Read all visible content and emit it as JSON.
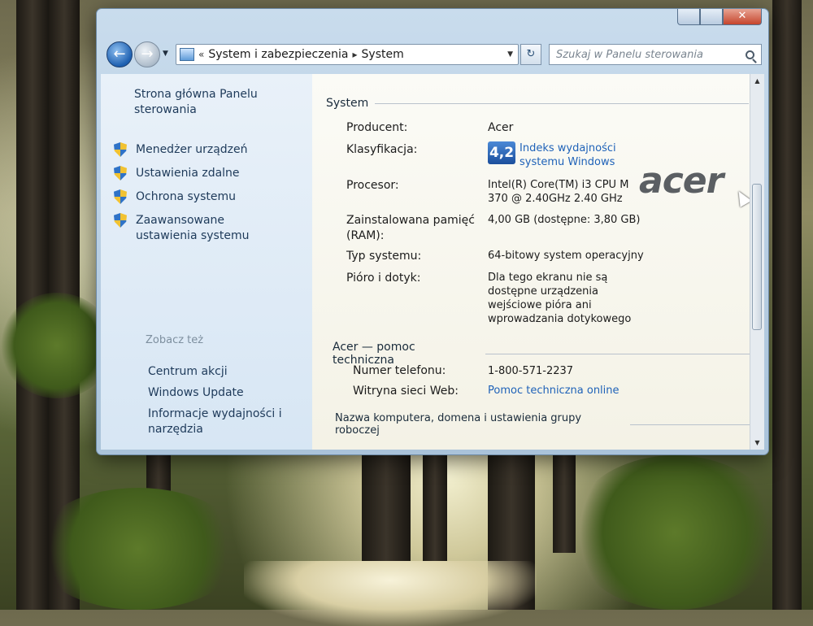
{
  "window": {
    "close_glyph": "✕"
  },
  "address_bar": {
    "prefix": "«",
    "crumbs": [
      "System i zabezpieczenia",
      "System"
    ],
    "separator": "▸",
    "search_placeholder": "Szukaj w Panelu sterowania"
  },
  "sidebar": {
    "home": "Strona główna Panelu sterowania",
    "tasks": [
      "Menedżer urządzeń",
      "Ustawienia zdalne",
      "Ochrona systemu",
      "Zaawansowane ustawienia systemu"
    ],
    "see_also_title": "Zobacz też",
    "see_also_links": [
      "Centrum akcji",
      "Windows Update",
      "Informacje wydajności i narzędzia"
    ]
  },
  "system": {
    "section_title": "System",
    "manufacturer_label": "Producent:",
    "manufacturer_value": "Acer",
    "rating_label": "Klasyfikacja:",
    "rating_score": "4,2",
    "rating_link": "Indeks wydajności systemu Windows",
    "processor_label": "Procesor:",
    "processor_value": "Intel(R) Core(TM) i3 CPU M 370 @ 2.40GHz 2.40 GHz",
    "ram_label": "Zainstalowana pamięć (RAM):",
    "ram_value": "4,00 GB (dostępne: 3,80 GB)",
    "type_label": "Typ systemu:",
    "type_value": "64-bitowy system operacyjny",
    "pen_label": "Pióro i dotyk:",
    "pen_value": "Dla tego ekranu nie są dostępne urządzenia wejściowe pióra ani wprowadzania dotykowego"
  },
  "support": {
    "section_title": "Acer — pomoc techniczna",
    "phone_label": "Numer telefonu:",
    "phone_value": "1-800-571-2237",
    "web_label": "Witryna sieci Web:",
    "web_value": "Pomoc techniczna online"
  },
  "computer": {
    "section_title": "Nazwa komputera, domena i ustawienia grupy roboczej"
  },
  "logo": {
    "text": "acer"
  }
}
